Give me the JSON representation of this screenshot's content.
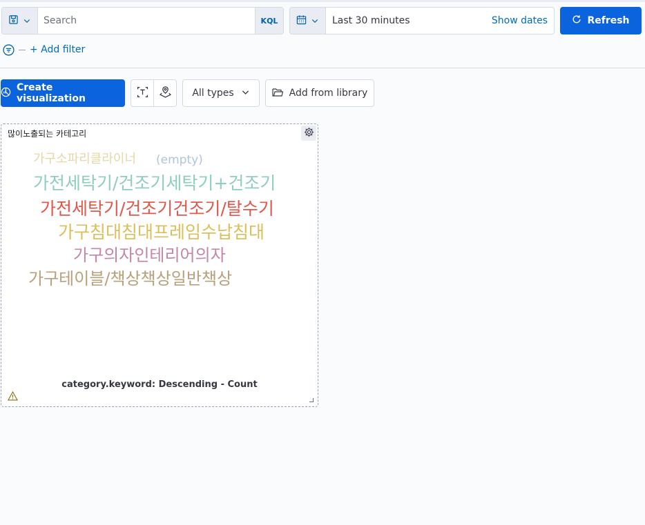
{
  "query_bar": {
    "search_placeholder": "Search",
    "language_label": "KQL",
    "time_range_label": "Last 30 minutes",
    "show_dates_label": "Show dates",
    "refresh_label": "Refresh"
  },
  "filters": {
    "add_filter_label": "+ Add filter"
  },
  "toolbar": {
    "create_visualization_label": "Create visualization",
    "all_types_label": "All types",
    "add_from_library_label": "Add from library"
  },
  "panel": {
    "title": "많이노출되는 카테고리",
    "caption": "category.keyword: Descending - Count",
    "words": [
      {
        "text": "가구소파리클라이너",
        "color": "#e6d8a6"
      },
      {
        "text": "(empty)",
        "color": "#b0c4dc"
      },
      {
        "text": "가전세탁기/건조기세탁기+건조기",
        "color": "#8fcdc1"
      },
      {
        "text": "가전세탁기/건조기건조기/탈수기",
        "color": "#e0574a"
      },
      {
        "text": "가구침대침대프레임수납침대",
        "color": "#dcbf5a"
      },
      {
        "text": "가구의자인테리어의자",
        "color": "#c486a8"
      },
      {
        "text": "가구테이블/책상책상일반책상",
        "color": "#b8a07a"
      }
    ]
  },
  "colors": {
    "primary": "#0b64dd",
    "link": "#006bb8",
    "border": "#d3dae6"
  }
}
